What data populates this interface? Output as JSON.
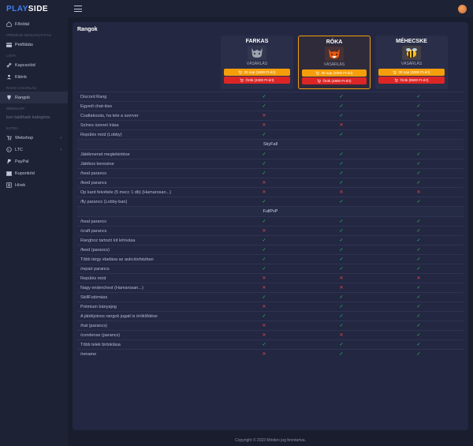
{
  "logo": {
    "a": "PLAY",
    "b": "SIDE"
  },
  "nav": {
    "foold": "Főoldal",
    "s1": "PRÉMIUM SZOLGÁLTATÁS",
    "pet": "Petőlátás",
    "s2": "LISTA",
    "kaps": "Kapcsolód",
    "kliens": "Kliénk",
    "s3": "RANG VÁSÁRLÁS",
    "rang": "Rangok",
    "s4": "WEBSHOP",
    "noshop": "ken található kategória",
    "s5": "EXTRA",
    "web": "Webshop",
    "ltc": "LTC",
    "pp": "PayPal",
    "kup": "Kuponkód",
    "hir": "Hírek"
  },
  "title": "Rangok",
  "cards": [
    {
      "name": "FARKAS",
      "sub": "VÁSÁRLÁS",
      "b30": "30 nap (1500 Ft-ért)",
      "bperm": "Örök (3400 Ft-ért)",
      "color": "#6b7280",
      "img": "wolf",
      "featured": false
    },
    {
      "name": "RÓKA",
      "sub": "VÁSÁRLÁS",
      "b30": "30 nap (2000 Ft-ért)",
      "bperm": "Örök (4800 Ft-ért)",
      "color": "#ea580c",
      "img": "fox",
      "featured": true
    },
    {
      "name": "MÉHECSKE",
      "sub": "VÁSÁRLÁS",
      "b30": "30 nap (3000 Ft-ért)",
      "bperm": "Örök (8500 Ft-ért)",
      "color": "#fbbf24",
      "img": "bee",
      "featured": false
    }
  ],
  "features": [
    {
      "l": "Discord Rang",
      "v": [
        "y",
        "y",
        "y"
      ]
    },
    {
      "l": "Egyedi chat-kiss",
      "v": [
        "y",
        "y",
        "y"
      ]
    },
    {
      "l": "Csatlakozás, ha tele a szerver",
      "v": [
        "n",
        "y",
        "y"
      ]
    },
    {
      "l": "Színes üzenet írása",
      "v": [
        "n",
        "n",
        "y"
      ]
    },
    {
      "l": "Repülés mód (Lobby)",
      "v": [
        "y",
        "y",
        "y"
      ]
    }
  ],
  "sec1": "SkyFall",
  "features2": [
    {
      "l": "Játékmenet megtekintése",
      "v": [
        "y",
        "y",
        "y"
      ]
    },
    {
      "l": "Játékos keresése",
      "v": [
        "y",
        "y",
        "y"
      ]
    },
    {
      "l": "/heal parancs",
      "v": [
        "y",
        "y",
        "y"
      ]
    },
    {
      "l": "/feed parancs",
      "v": [
        "n",
        "y",
        "y"
      ]
    },
    {
      "l": "Op kard felvétele (5 mecc 1 db) (Hamarosan...)",
      "v": [
        "n",
        "n",
        "n"
      ]
    },
    {
      "l": "/fly parancs (Lobby-ban)",
      "v": [
        "y",
        "y",
        "y"
      ]
    }
  ],
  "sec2": "FullPvP",
  "features3": [
    {
      "l": "/heal parancs",
      "v": [
        "y",
        "y",
        "y"
      ]
    },
    {
      "l": "/craft parancs",
      "v": [
        "n",
        "y",
        "y"
      ]
    },
    {
      "l": "Ranghoz tartozó kit lehívása",
      "v": [
        "y",
        "y",
        "y"
      ]
    },
    {
      "l": "/feed (parancs)",
      "v": [
        "y",
        "y",
        "y"
      ]
    },
    {
      "l": "Több tárgy eladása az aukciósházban",
      "v": [
        "y",
        "y",
        "y"
      ]
    },
    {
      "l": "/repair parancs",
      "v": [
        "y",
        "y",
        "y"
      ]
    },
    {
      "l": "Repülés mód",
      "v": [
        "n",
        "n",
        "n"
      ]
    },
    {
      "l": "Nagy enderchest (Hamarosan...)",
      "v": [
        "n",
        "n",
        "y"
      ]
    },
    {
      "l": "SkillFutómáss",
      "v": [
        "y",
        "y",
        "y"
      ]
    },
    {
      "l": "Prémium bányajog",
      "v": [
        "n",
        "y",
        "y"
      ]
    },
    {
      "l": "A játékjoinos rangok jogait is öröklődése",
      "v": [
        "y",
        "y",
        "y"
      ]
    },
    {
      "l": "/hat (parancs)",
      "v": [
        "n",
        "y",
        "y"
      ]
    },
    {
      "l": "/condense (parancs)",
      "v": [
        "n",
        "n",
        "y"
      ]
    },
    {
      "l": "Több telek birtoklása",
      "v": [
        "y",
        "y",
        "y"
      ]
    },
    {
      "l": "/rename",
      "v": [
        "n",
        "y",
        "y"
      ]
    }
  ],
  "footer": "Copyright © 2023 Minden jog fenntartva."
}
